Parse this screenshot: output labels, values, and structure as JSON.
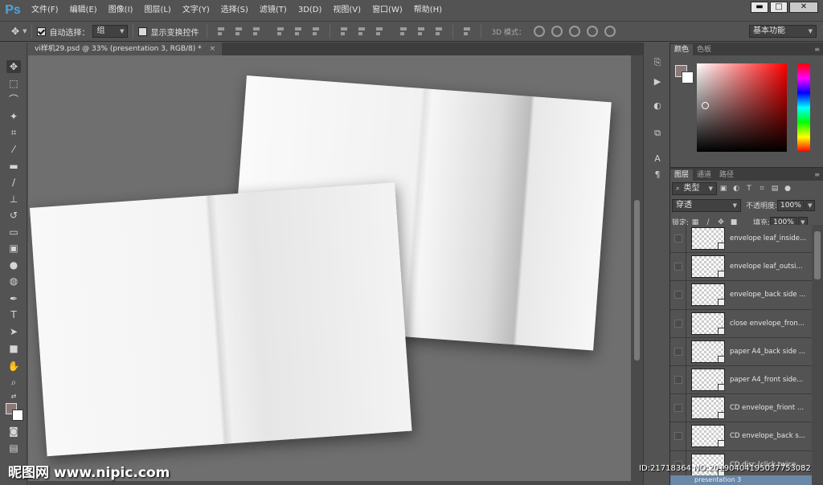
{
  "app": {
    "logo": "Ps"
  },
  "menu": [
    "文件(F)",
    "编辑(E)",
    "图像(I)",
    "图层(L)",
    "文字(Y)",
    "选择(S)",
    "滤镜(T)",
    "3D(D)",
    "视图(V)",
    "窗口(W)",
    "帮助(H)"
  ],
  "window_controls": {
    "minimize": "▬",
    "maximize": "□",
    "close": "✕"
  },
  "options": {
    "auto_select_label": "自动选择：",
    "auto_select_checked": true,
    "auto_select_value": "组",
    "show_transform_label": "显示变换控件",
    "show_transform_checked": false,
    "mode3d_label": "3D 模式：",
    "workspace": "基本功能"
  },
  "document": {
    "tab_title": "vi样机29.psd @ 33% (presentation 3, RGB/8) *",
    "close": "×"
  },
  "color_panel": {
    "tabs": [
      "颜色",
      "色板"
    ],
    "fg": "#8a7877",
    "bg": "#ffffff"
  },
  "layers_panel": {
    "tabs": [
      "图层",
      "通道",
      "路径"
    ],
    "filter_kind": "类型",
    "blend_mode": "穿透",
    "opacity_label": "不透明度:",
    "opacity_value": "100%",
    "lock_label": "锁定:",
    "fill_label": "填充:",
    "fill_value": "100%",
    "layers": [
      "envelope leaf_inside...",
      "envelope leaf_outsi...",
      "envelope_back side ...",
      "close envelope_fron...",
      "paper A4_back side ...",
      "paper A4_front side...",
      "CD envelope_friont ...",
      "CD envelope_back s...",
      "CD disc (click twice ..."
    ],
    "group": "presentation 3"
  },
  "watermark": {
    "logo": "昵图网 www.nipic.com",
    "id": "ID:21718364 NO:20190404195037753082"
  }
}
